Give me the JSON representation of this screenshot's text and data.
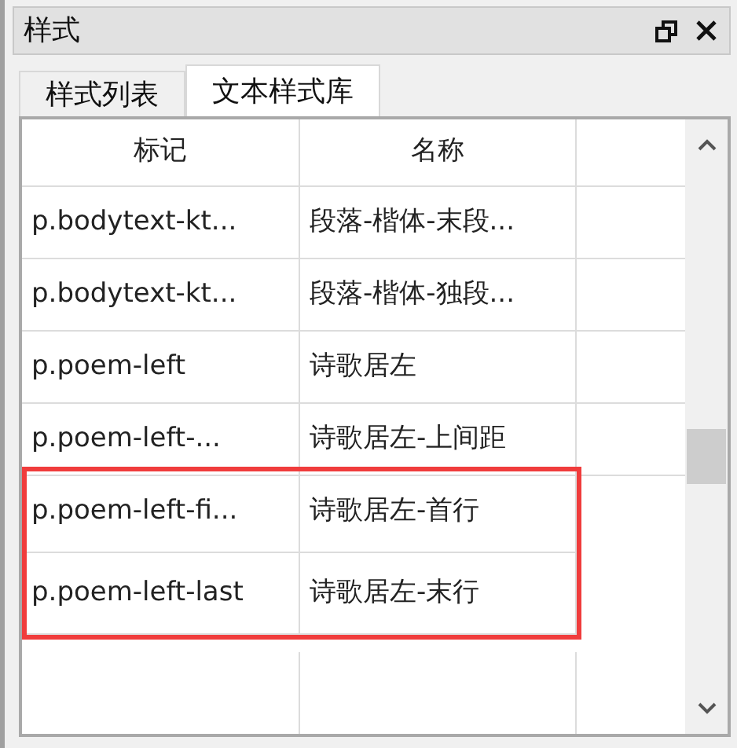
{
  "panel": {
    "title": "样式",
    "tabs": [
      {
        "label": "样式列表",
        "selected": false
      },
      {
        "label": "文本样式库",
        "selected": true
      }
    ]
  },
  "table": {
    "columns": [
      "标记",
      "名称"
    ],
    "rows": [
      {
        "tag": "p.bodytext-kt...",
        "name": "段落-楷体-末段...",
        "highlighted": false
      },
      {
        "tag": "p.bodytext-kt...",
        "name": "段落-楷体-独段...",
        "highlighted": false
      },
      {
        "tag": "p.poem-left",
        "name": "诗歌居左",
        "highlighted": false
      },
      {
        "tag": "p.poem-left-...",
        "name": "诗歌居左-上间距",
        "highlighted": false
      },
      {
        "tag": "p.poem-left-fi...",
        "name": "诗歌居左-首行",
        "highlighted": true
      },
      {
        "tag": "p.poem-left-last",
        "name": "诗歌居左-末行",
        "highlighted": true
      }
    ]
  }
}
